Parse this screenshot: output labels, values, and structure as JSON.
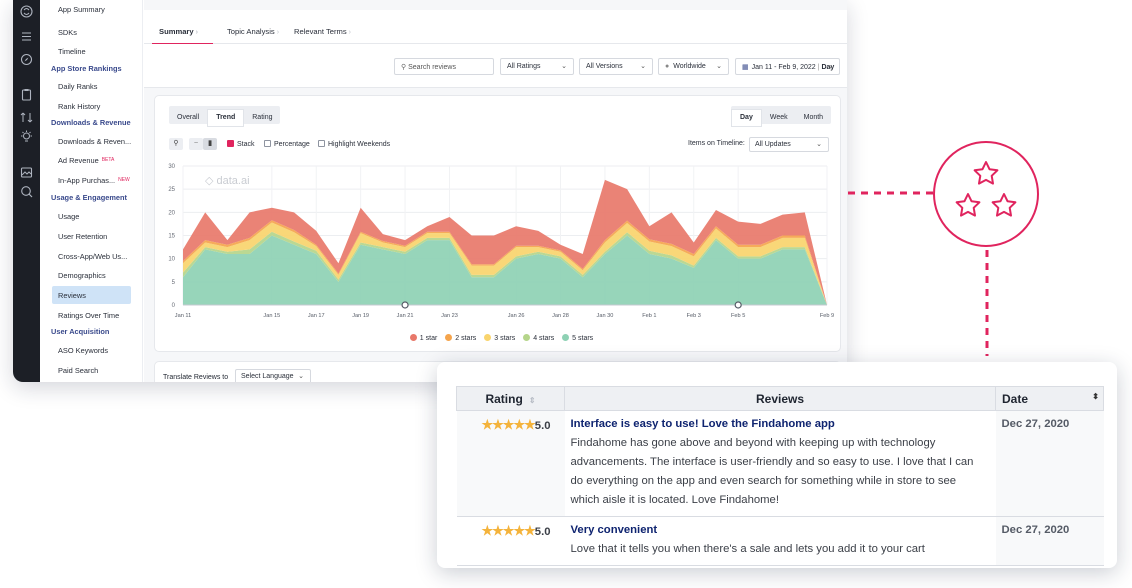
{
  "sidebar": {
    "items": [
      {
        "label": "App Summary",
        "section": false
      },
      {
        "label": "SDKs",
        "section": false
      },
      {
        "label": "Timeline",
        "section": false
      },
      {
        "label": "App Store Rankings",
        "section": true
      },
      {
        "label": "Daily Ranks",
        "section": false
      },
      {
        "label": "Rank History",
        "section": false
      },
      {
        "label": "Downloads & Revenue",
        "section": true
      },
      {
        "label": "Downloads & Reven...",
        "section": false
      },
      {
        "label": "Ad Revenue",
        "section": false,
        "tag": "BETA"
      },
      {
        "label": "In-App Purchas...",
        "section": false,
        "tag": "NEW"
      },
      {
        "label": "Usage & Engagement",
        "section": true
      },
      {
        "label": "Usage",
        "section": false
      },
      {
        "label": "User Retention",
        "section": false
      },
      {
        "label": "Cross-App/Web Us...",
        "section": false
      },
      {
        "label": "Demographics",
        "section": false
      },
      {
        "label": "Reviews",
        "section": false,
        "active": true
      },
      {
        "label": "Ratings Over Time",
        "section": false
      },
      {
        "label": "User Acquisition",
        "section": true
      },
      {
        "label": "ASO Keywords",
        "section": false
      },
      {
        "label": "Paid Search",
        "section": false
      }
    ]
  },
  "tabs": [
    "Summary",
    "Topic Analysis",
    "Relevant Terms"
  ],
  "filters": {
    "search_placeholder": "Search reviews",
    "ratings": "All Ratings",
    "versions": "All Versions",
    "region": "Worldwide",
    "date_range": "Jan 11 - Feb 9, 2022",
    "granularity": "Day"
  },
  "view_tabs": [
    "Overall",
    "Trend",
    "Rating"
  ],
  "period_tabs": [
    "Day",
    "Week",
    "Month"
  ],
  "options": {
    "stack": "Stack",
    "percentage": "Percentage",
    "highlight_weekends": "Highlight Weekends",
    "items_on_timeline_label": "Items on Timeline:",
    "items_on_timeline_value": "All Updates"
  },
  "watermark": "data.ai",
  "translate": {
    "label": "Translate Reviews to",
    "select": "Select Language"
  },
  "colors": {
    "accent": "#e0245e",
    "s1": "#e8786a",
    "s2": "#f5a44c",
    "s3": "#f9d46d",
    "s4": "#b5d58a",
    "s5": "#8ed1b4"
  },
  "chart_data": {
    "type": "area",
    "stacked": true,
    "ylim": [
      0,
      30
    ],
    "yticks": [
      0,
      5,
      10,
      15,
      20,
      25,
      30
    ],
    "x_tick_labels": [
      "Jan 11",
      "Jan 15",
      "Jan 17",
      "Jan 19",
      "Jan 21",
      "Jan 23",
      "Jan 26",
      "Jan 28",
      "Jan 30",
      "Feb 1",
      "Feb 3",
      "Feb 5",
      "Feb 9"
    ],
    "x_tick_index": [
      0,
      4,
      6,
      8,
      10,
      12,
      15,
      17,
      19,
      21,
      23,
      25,
      29
    ],
    "markers_at": [
      10,
      25
    ],
    "legend_position": "bottom",
    "series": [
      {
        "name": "5 stars",
        "values": [
          6,
          12,
          11,
          11,
          15,
          13,
          11,
          5,
          13,
          12,
          11,
          14,
          14,
          6,
          6,
          10,
          11,
          10,
          6,
          11,
          15,
          11,
          10,
          8,
          14,
          10,
          10,
          12,
          12,
          0
        ]
      },
      {
        "name": "4 stars",
        "values": [
          1,
          0.5,
          0.5,
          1,
          0.8,
          0.7,
          0.7,
          0.5,
          0.5,
          0.5,
          0.5,
          0.5,
          0.5,
          0.5,
          0.5,
          0.5,
          0.5,
          0.5,
          0.5,
          0.5,
          0.7,
          0.7,
          0.7,
          0.5,
          0.5,
          0.5,
          0.5,
          0.5,
          0.5,
          0
        ]
      },
      {
        "name": "3 stars",
        "values": [
          2,
          1,
          1,
          2,
          2,
          2,
          1,
          1,
          2,
          1,
          1,
          1,
          1,
          2,
          2,
          2,
          1,
          1,
          1,
          2,
          2,
          2,
          2,
          2,
          2,
          2,
          2,
          2,
          2,
          0
        ]
      },
      {
        "name": "2 stars",
        "values": [
          0.5,
          0.5,
          0.5,
          0.5,
          0.5,
          0.5,
          0.3,
          0.3,
          0.3,
          0.3,
          0.3,
          0.3,
          0.3,
          0.3,
          0.3,
          0.3,
          0.3,
          0.3,
          0.3,
          0.5,
          0.5,
          0.5,
          0.5,
          0.5,
          0.5,
          0.5,
          0.5,
          0.5,
          0.5,
          0
        ]
      },
      {
        "name": "1 star",
        "values": [
          2.5,
          6,
          1,
          5.5,
          2.7,
          3.8,
          3,
          2.2,
          5.2,
          1.5,
          1.2,
          1.2,
          3.2,
          6.2,
          6.2,
          4.2,
          3.2,
          1.2,
          3.2,
          13,
          6.8,
          2.8,
          6.8,
          2.5,
          3.5,
          5,
          4.5,
          4.5,
          5,
          0
        ]
      }
    ]
  },
  "reviews_table": {
    "headers": {
      "rating": "Rating",
      "reviews": "Reviews",
      "date": "Date"
    },
    "rows": [
      {
        "stars": "★★★★★",
        "rating": "5.0",
        "title": "Interface is easy to use! Love the Findahome app",
        "body": "Findahome has gone above and beyond with keeping up with technology advancements. The interface is user-friendly and so easy to use. I love that I can do everything on the app and even search for something while in store to see which aisle it is located. Love Findahome!",
        "date": "Dec 27, 2020"
      },
      {
        "stars": "★★★★★",
        "rating": "5.0",
        "title": "Very convenient",
        "body": "Love that it tells you when there's a sale and lets you add it to your cart",
        "date": "Dec 27, 2020"
      }
    ]
  }
}
